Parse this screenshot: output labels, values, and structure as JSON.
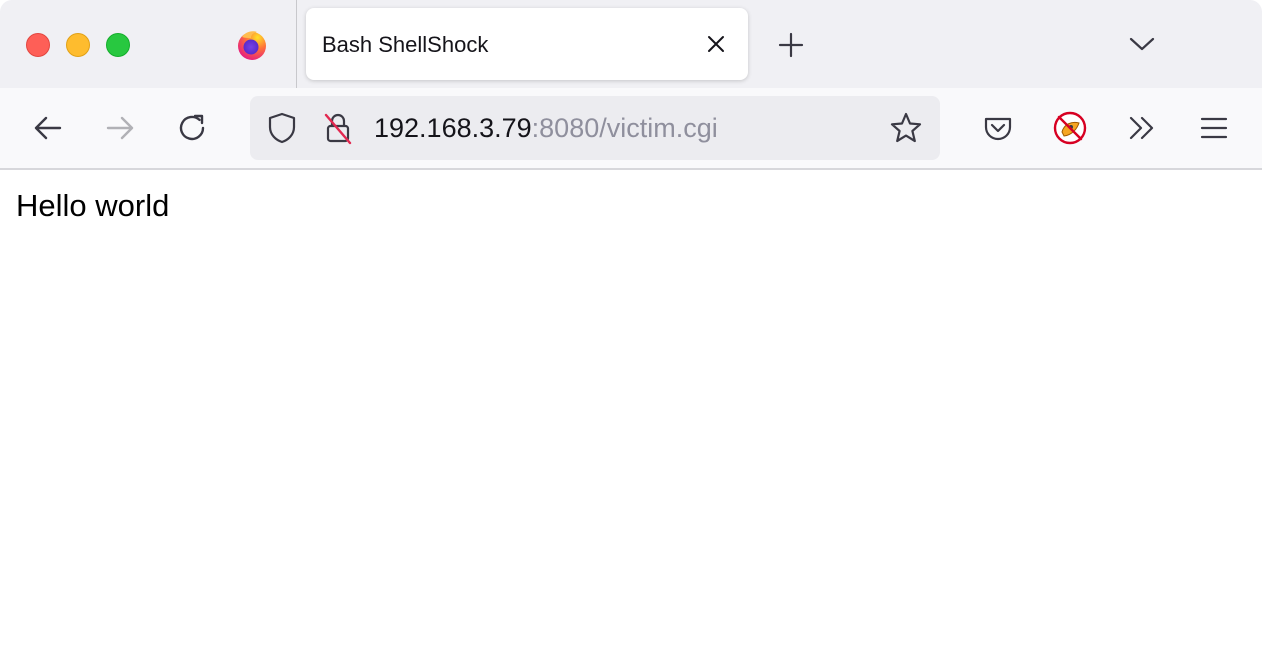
{
  "window": {
    "traffic_lights": {
      "close_color": "#fe5f57",
      "minimize_color": "#febc2e",
      "maximize_color": "#28c840"
    }
  },
  "tabs": [
    {
      "title": "Bash ShellShock",
      "active": true
    }
  ],
  "toolbar": {
    "back_icon": "arrow-left-icon",
    "forward_icon": "arrow-right-icon",
    "reload_icon": "reload-icon",
    "forward_enabled": false
  },
  "urlbar": {
    "host": "192.168.3.79",
    "rest": ":8080/victim.cgi",
    "shield_icon": "tracking-protection-shield-icon",
    "lock_icon": "insecure-lock-icon",
    "bookmark_icon": "star-icon"
  },
  "toolbar_right": {
    "icons": [
      "pocket-icon",
      "extension-icon",
      "overflow-chevron-icon",
      "hamburger-menu-icon"
    ]
  },
  "page": {
    "body_text": "Hello world"
  }
}
